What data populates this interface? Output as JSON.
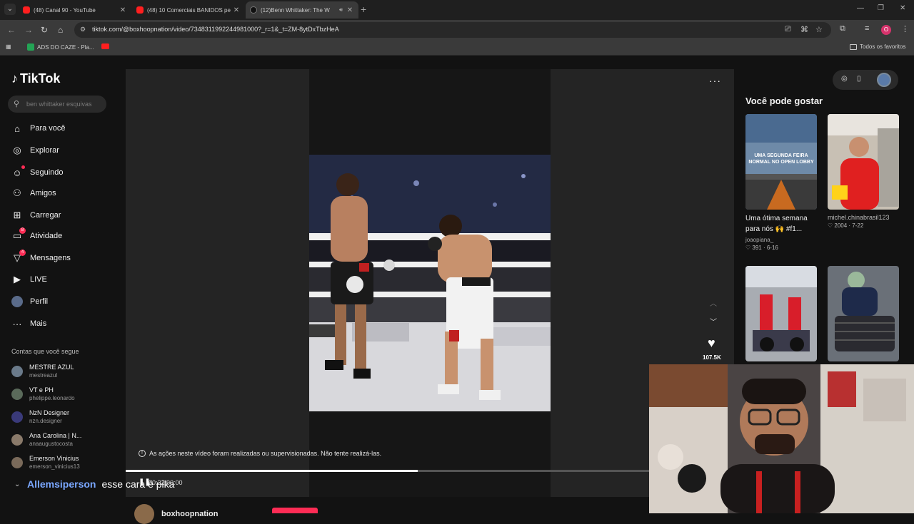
{
  "browser": {
    "tabs": [
      {
        "title": "(48) Canal 90 - YouTube",
        "icon": "youtube-icon"
      },
      {
        "title": "(48) 10 Comerciais BANIDOS pe",
        "icon": "youtube-icon"
      },
      {
        "title": "(12)Benn Whittaker: The W",
        "icon": "tiktok-icon"
      }
    ],
    "url": "tiktok.com/@boxhoopnation/video/7348311992244981000?_r=1&_t=ZM-8ytDxTbzHeA",
    "bookmarks": [
      {
        "label": "ADS DO CAZE - Pla..."
      },
      {
        "label": ""
      }
    ],
    "all_favorites": "Todos os favoritos",
    "profile_initial": "O"
  },
  "tiktok": {
    "brand": "TikTok",
    "search_placeholder": "ben whittaker esquivas",
    "nav": [
      {
        "label": "Para você",
        "icon": "home-icon"
      },
      {
        "label": "Explorar",
        "icon": "compass-icon"
      },
      {
        "label": "Seguindo",
        "icon": "following-icon"
      },
      {
        "label": "Amigos",
        "icon": "friends-icon"
      },
      {
        "label": "Carregar",
        "icon": "upload-icon"
      },
      {
        "label": "Atividade",
        "icon": "activity-icon",
        "badge": "8"
      },
      {
        "label": "Mensagens",
        "icon": "messages-icon",
        "badge": "4"
      },
      {
        "label": "LIVE",
        "icon": "live-icon"
      },
      {
        "label": "Perfil",
        "icon": "avatar"
      },
      {
        "label": "Mais",
        "icon": "more-icon"
      }
    ],
    "following_header": "Contas que você segue",
    "following": [
      {
        "name": "MESTRE AZUL",
        "handle": "mestreazul",
        "color": "#6a7a8a"
      },
      {
        "name": "VT e PH",
        "handle": "phelippe.leonardo",
        "color": "#5a6a5a"
      },
      {
        "name": "NzN Designer",
        "handle": "nzn.designer",
        "color": "#3a3a7a"
      },
      {
        "name": "Ana Carolina | N...",
        "handle": "anaaugustocosta",
        "color": "#8a7a6a"
      },
      {
        "name": "Emerson Vinicius",
        "handle": "emerson_vinicius13",
        "color": "#7a6a5a"
      }
    ],
    "player": {
      "warning": "As ações neste vídeo foram realizadas ou supervisionadas. Não tente realizá-las.",
      "likes": "107.5K",
      "time": "00:22/00:00",
      "progress": 0.48,
      "author": "boxhoopnation"
    },
    "recommend_header": "Você pode gostar",
    "recommendations": [
      {
        "caption": "Uma ótima semana para nós 🙌 #f1...",
        "author": "joaopiana_",
        "stats": "♡ 391 · 6-16",
        "overlay": "UMA SEGUNDA FEIRA NORMAL NO OPEN LOBBY"
      },
      {
        "caption": "",
        "author": "michel.chinabrasil123",
        "stats": "♡ 2004 · 7-22",
        "overlay": ""
      },
      {
        "caption": "",
        "author": "",
        "stats": "",
        "overlay": ""
      },
      {
        "caption": "",
        "author": "",
        "stats": "",
        "overlay": ""
      }
    ]
  },
  "chat": {
    "user": "Allemsiperson",
    "message": "esse cara é pika"
  },
  "colors": {
    "accent": "#fe2c55",
    "background": "#121212",
    "player": "#242424"
  }
}
